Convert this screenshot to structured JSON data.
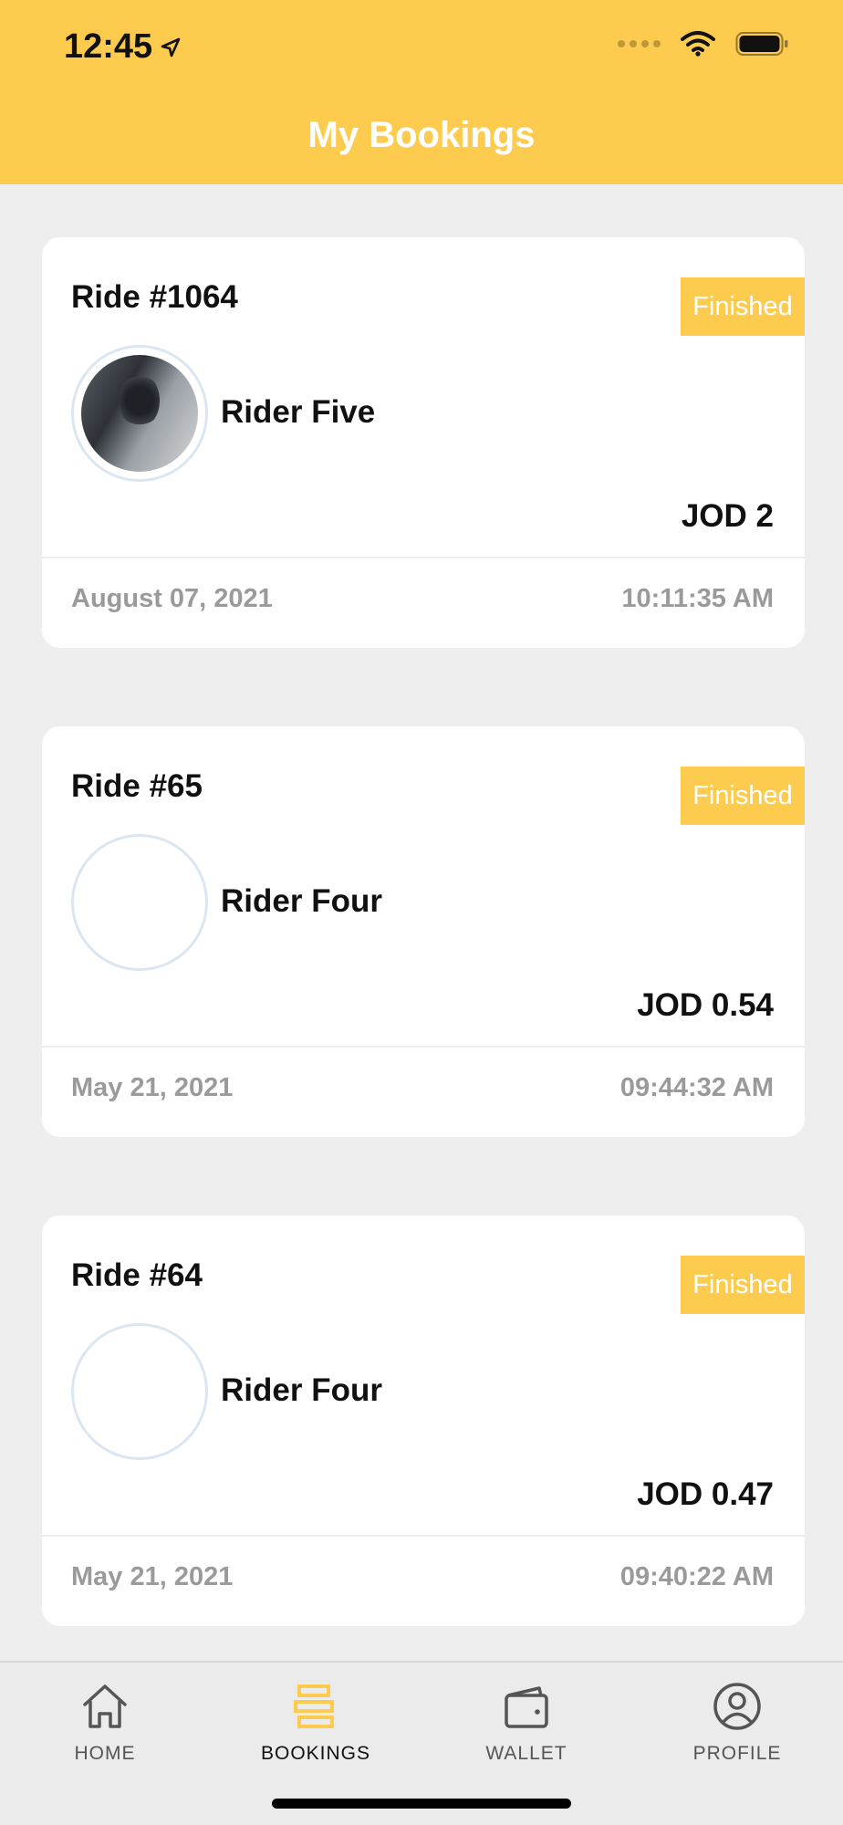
{
  "status_bar": {
    "time": "12:45"
  },
  "header": {
    "title": "My Bookings"
  },
  "bookings": [
    {
      "ride": "Ride #1064",
      "status": "Finished",
      "rider": "Rider Five",
      "price": "JOD 2",
      "date": "August 07, 2021",
      "time": "10:11:35 AM",
      "has_photo": true
    },
    {
      "ride": "Ride #65",
      "status": "Finished",
      "rider": "Rider Four",
      "price": "JOD 0.54",
      "date": "May 21, 2021",
      "time": "09:44:32 AM",
      "has_photo": false
    },
    {
      "ride": "Ride #64",
      "status": "Finished",
      "rider": "Rider Four",
      "price": "JOD 0.47",
      "date": "May 21, 2021",
      "time": "09:40:22 AM",
      "has_photo": false
    }
  ],
  "tabbar": {
    "active": "bookings",
    "items": [
      {
        "id": "home",
        "label": "HOME",
        "icon": "home-icon"
      },
      {
        "id": "bookings",
        "label": "BOOKINGS",
        "icon": "bookings-icon"
      },
      {
        "id": "wallet",
        "label": "WALLET",
        "icon": "wallet-icon"
      },
      {
        "id": "profile",
        "label": "PROFILE",
        "icon": "profile-icon"
      }
    ]
  },
  "colors": {
    "accent": "#fdcb4e",
    "background": "#eeeeee",
    "muted_text": "#9a9a9a"
  }
}
